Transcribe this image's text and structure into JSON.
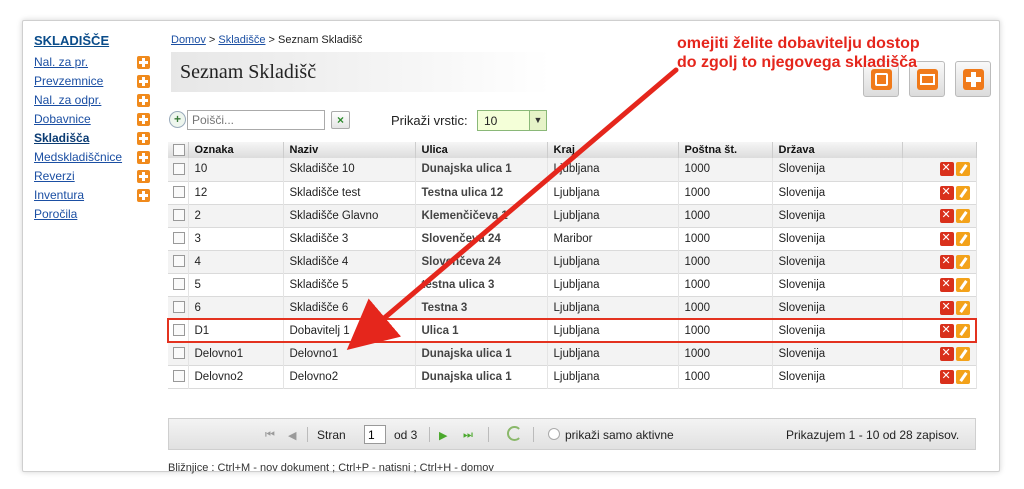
{
  "sidebar": {
    "title": "SKLADIŠČE",
    "items": [
      {
        "label": "Nal. za pr.",
        "has_add": true
      },
      {
        "label": "Prevzemnice",
        "has_add": true
      },
      {
        "label": "Nal. za odpr.",
        "has_add": true
      },
      {
        "label": "Dobavnice",
        "has_add": true
      },
      {
        "label": "Skladišča",
        "has_add": true,
        "active": true
      },
      {
        "label": "Medskladiščnice",
        "has_add": true
      },
      {
        "label": "Reverzi",
        "has_add": true
      },
      {
        "label": "Inventura",
        "has_add": true
      },
      {
        "label": "Poročila",
        "has_add": false
      }
    ]
  },
  "breadcrumb": {
    "home": "Domov",
    "sep1": " > ",
    "section": "Skladišče",
    "sep2": " > ",
    "current": "Seznam Skladišč"
  },
  "page_title": "Seznam Skladišč",
  "toolbar": {
    "search_placeholder": "Poišči...",
    "clear_label": "×",
    "rows_label": "Prikaži vrstic:",
    "rows_value": "10"
  },
  "table": {
    "headers": [
      "Oznaka",
      "Naziv",
      "Ulica",
      "Kraj",
      "Poštna št.",
      "Država"
    ],
    "rows": [
      [
        "10",
        "Skladišče 10",
        "Dunajska ulica 1",
        "Ljubljana",
        "1000",
        "Slovenija"
      ],
      [
        "12",
        "Skladišče test",
        "Testna ulica 12",
        "Ljubljana",
        "1000",
        "Slovenija"
      ],
      [
        "2",
        "Skladišče Glavno",
        "Klemenčičeva 1",
        "Ljubljana",
        "1000",
        "Slovenija"
      ],
      [
        "3",
        "Skladišče 3",
        "Slovenčeva 24",
        "Maribor",
        "1000",
        "Slovenija"
      ],
      [
        "4",
        "Skladišče 4",
        "Slovenčeva 24",
        "Ljubljana",
        "1000",
        "Slovenija"
      ],
      [
        "5",
        "Skladišče 5",
        "testna ulica 3",
        "Ljubljana",
        "1000",
        "Slovenija"
      ],
      [
        "6",
        "Skladišče 6",
        "Testna 3",
        "Ljubljana",
        "1000",
        "Slovenija"
      ],
      [
        "D1",
        "Dobavitelj 1",
        "Ulica 1",
        "Ljubljana",
        "1000",
        "Slovenija"
      ],
      [
        "Delovno1",
        "Delovno1",
        "Dunajska ulica 1",
        "Ljubljana",
        "1000",
        "Slovenija"
      ],
      [
        "Delovno2",
        "Delovno2",
        "Dunajska ulica 1",
        "Ljubljana",
        "1000",
        "Slovenija"
      ]
    ],
    "highlighted_row": 7
  },
  "pager": {
    "page_label": "Stran",
    "page_value": "1",
    "of_label": "od 3",
    "active_only_label": "prikaži samo aktivne",
    "summary": "Prikazujem 1 - 10 od 28 zapisov."
  },
  "shortcuts": "Bližnjice : Ctrl+M - nov dokument ;  Ctrl+P - natisni ;  Ctrl+H - domov",
  "annotation": {
    "line1": "omejiti želite dobavitelju dostop",
    "line2": "do zgolj to njegovega skladišča",
    "color": "#e5261c"
  },
  "colors": {
    "accent_orange": "#f08a1c",
    "link_blue": "#1b4fa3",
    "select_bg": "#f4ffd8"
  }
}
